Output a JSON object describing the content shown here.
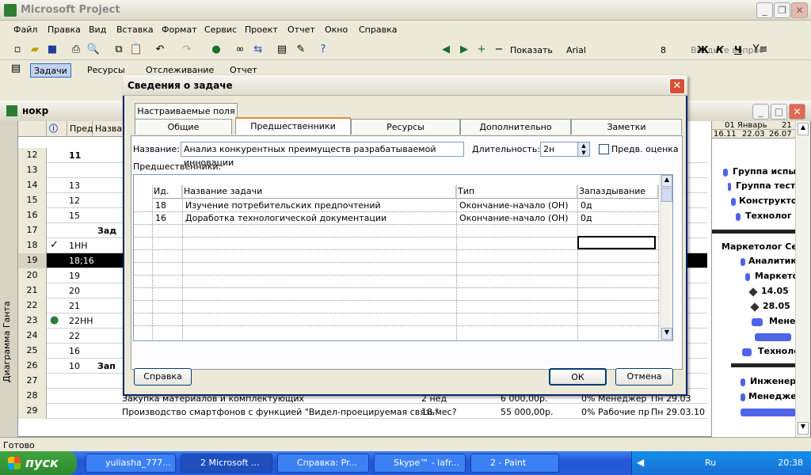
{
  "app": {
    "title": "Microsoft Project"
  },
  "menu": [
    {
      "label": "Файл"
    },
    {
      "label": "Правка"
    },
    {
      "label": "Вид"
    },
    {
      "label": "Вставка"
    },
    {
      "label": "Формат"
    },
    {
      "label": "Сервис"
    },
    {
      "label": "Проект"
    },
    {
      "label": "Отчет"
    },
    {
      "label": "Окно"
    },
    {
      "label": "Справка"
    }
  ],
  "search": {
    "placeholder": "Введите вопрос"
  },
  "toolbar1": {
    "show_label": "Показать",
    "font": "Arial",
    "size": "8",
    "bold": "Ж",
    "italic": "К",
    "underline": "Ч"
  },
  "toolbar2": {
    "tasks": "Задачи",
    "resources": "Ресурсы",
    "tracking": "Отслеживание",
    "report": "Отчет"
  },
  "project": {
    "window_title": "нокр",
    "side_label": "Диаграмма Ганта",
    "col_pred": "Пред",
    "col_name": "Назван"
  },
  "rows": [
    {
      "id": "12",
      "pred": "11",
      "name": "",
      "bold": true
    },
    {
      "id": "13",
      "pred": "",
      "name": ""
    },
    {
      "id": "14",
      "pred": "13",
      "name": ""
    },
    {
      "id": "15",
      "pred": "12",
      "name": ""
    },
    {
      "id": "16",
      "pred": "15",
      "name": ""
    },
    {
      "id": "17",
      "pred": "",
      "name": "Зад"
    },
    {
      "id": "18",
      "pred": "1НН",
      "name": ""
    },
    {
      "id": "19",
      "pred": "18;16",
      "name": ""
    },
    {
      "id": "20",
      "pred": "19",
      "name": ""
    },
    {
      "id": "21",
      "pred": "20",
      "name": ""
    },
    {
      "id": "22",
      "pred": "21",
      "name": ""
    },
    {
      "id": "23",
      "pred": "22НН",
      "name": ""
    },
    {
      "id": "24",
      "pred": "22",
      "name": ""
    },
    {
      "id": "25",
      "pred": "16",
      "name": ""
    },
    {
      "id": "26",
      "pred": "10",
      "name": "Зап"
    },
    {
      "id": "27",
      "pred": "",
      "name": ""
    },
    {
      "id": "28",
      "pred": "",
      "name": ""
    },
    {
      "id": "29",
      "pred": "",
      "name": ""
    }
  ],
  "row29": {
    "name": "Производство смартфонов с функцией \"Видел-проецируемая связь\"",
    "duration": "18 мес?",
    "cost": "55 000,00р.",
    "pct": "0%",
    "resource": "Рабочие пр",
    "start": "Пн 29.03.10"
  },
  "row28": {
    "name": "Закупка материалов и комплектующих",
    "duration": "2 нед",
    "cost": "6 000,00р.",
    "pct": "0%",
    "resource": "Менеджер",
    "start": "Пн 29.03"
  },
  "gantt": {
    "month": "01 Январь",
    "day21": "21",
    "dates": [
      "16.11",
      "22.03",
      "26.07"
    ],
    "labels": [
      "Группа испыт",
      "Группа тесте",
      "Конструктор",
      "Технолог Е",
      "Маркетолог Сев",
      "Аналитик",
      "Маркето",
      "14.05",
      "28.05",
      "Менед",
      "Техноло",
      "Инженер",
      "Менеджер"
    ]
  },
  "status": "Готово",
  "dialog": {
    "title": "Сведения о задаче",
    "tabs_top": [
      "Настраиваемые поля"
    ],
    "tabs": [
      "Общие",
      "Предшественники",
      "Ресурсы",
      "Дополнительно",
      "Заметки"
    ],
    "name_label": "Название:",
    "name_value": "Анализ конкурентных преимуществ разрабатываемой инновации",
    "duration_label": "Длительность:",
    "duration_value": "2н",
    "estimate_label": "Предв. оценка",
    "pred_label": "Предшественники:",
    "grid_headers": [
      "Ид.",
      "Название задачи",
      "Тип",
      "Запаздывание"
    ],
    "grid_rows": [
      {
        "id": "18",
        "name": "Изучение потребительских предпочтений",
        "type": "Окончание-начало (ОН)",
        "lag": "0д"
      },
      {
        "id": "16",
        "name": "Доработка технологической документации",
        "type": "Окончание-начало (ОН)",
        "lag": "0д"
      }
    ],
    "help_button": "Справка",
    "ok_button": "ОК",
    "cancel_button": "Отмена"
  },
  "taskbar": {
    "start": "пуск",
    "items": [
      "yuliasha_777...",
      "2 Microsoft ...",
      "Справка: Pr...",
      "Skype™ - lafr...",
      "2 - Paint"
    ],
    "lang": "Ru",
    "clock": "20:38"
  }
}
